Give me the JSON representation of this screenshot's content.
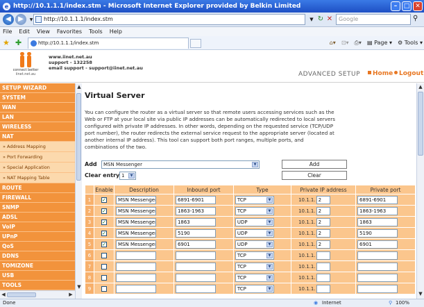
{
  "window": {
    "title": "http://10.1.1.1/index.stm - Microsoft Internet Explorer provided by Belkin Limited"
  },
  "address": {
    "url": "http://10.1.1.1/index.stm"
  },
  "search": {
    "placeholder": "Google"
  },
  "menu": [
    "File",
    "Edit",
    "View",
    "Favorites",
    "Tools",
    "Help"
  ],
  "tab": {
    "label": "http://10.1.1.1/index.stm"
  },
  "commands": {
    "page": "Page",
    "tools": "Tools"
  },
  "header": {
    "logo_tagline": "connect better",
    "logo_site": "iinet.net.au",
    "website": "www.iinet.net.au",
    "support_phone": "support - 132258",
    "support_email": "email support - support@iinet.net.au",
    "advanced_setup": "ADVANCED SETUP",
    "home_link": "Home",
    "logout_link": "Logout"
  },
  "sidebar": {
    "items": [
      {
        "label": "SETUP WIZARD",
        "sub": false
      },
      {
        "label": "SYSTEM",
        "sub": false
      },
      {
        "label": "WAN",
        "sub": false
      },
      {
        "label": "LAN",
        "sub": false
      },
      {
        "label": "WIRELESS",
        "sub": false
      },
      {
        "label": "NAT",
        "sub": false
      },
      {
        "label": "» Address Mapping",
        "sub": true
      },
      {
        "label": "» Port Forwarding",
        "sub": true
      },
      {
        "label": "» Special Application",
        "sub": true
      },
      {
        "label": "» NAT Mapping Table",
        "sub": true
      },
      {
        "label": "ROUTE",
        "sub": false
      },
      {
        "label": "FIREWALL",
        "sub": false
      },
      {
        "label": "SNMP",
        "sub": false
      },
      {
        "label": "ADSL",
        "sub": false
      },
      {
        "label": "VoIP",
        "sub": false
      },
      {
        "label": "UPnP",
        "sub": false
      },
      {
        "label": "QoS",
        "sub": false
      },
      {
        "label": "DDNS",
        "sub": false
      },
      {
        "label": "TOMIZONE",
        "sub": false
      },
      {
        "label": "USB",
        "sub": false
      },
      {
        "label": "TOOLS",
        "sub": false
      }
    ]
  },
  "main": {
    "title": "Virtual Server",
    "description": "You can configure the router as a virtual server so that remote users accessing services such as the Web or FTP at your local site via public IP addresses can be automatically redirected to local servers configured with private IP addresses. In other words, depending on the requested service (TCP/UDP port number), the router redirects the external service request to the appropriate server (located at another internal IP address). This tool can support both port ranges, multiple ports, and combinations of the two.",
    "add_label": "Add",
    "add_value": "MSN Messenger",
    "add_button": "Add",
    "clear_label": "Clear entry",
    "clear_value": "1",
    "clear_button": "Clear"
  },
  "table": {
    "headers": [
      "Enable",
      "Description",
      "Inbound port",
      "Type",
      "Private IP address",
      "Private port"
    ],
    "ip_prefix": "10.1.1.",
    "rows": [
      {
        "num": "1",
        "enabled": true,
        "desc": "MSN Messenger",
        "inbound": "6891-6901",
        "type": "TCP",
        "ip": "2",
        "private": "6891-6901"
      },
      {
        "num": "2",
        "enabled": true,
        "desc": "MSN Messenger",
        "inbound": "1863-1963",
        "type": "TCP",
        "ip": "2",
        "private": "1863-1963"
      },
      {
        "num": "3",
        "enabled": true,
        "desc": "MSN Messenger",
        "inbound": "1863",
        "type": "UDP",
        "ip": "2",
        "private": "1863"
      },
      {
        "num": "4",
        "enabled": true,
        "desc": "MSN Messenger",
        "inbound": "5190",
        "type": "UDP",
        "ip": "2",
        "private": "5190"
      },
      {
        "num": "5",
        "enabled": true,
        "desc": "MSN Messenger",
        "inbound": "6901",
        "type": "UDP",
        "ip": "2",
        "private": "6901"
      },
      {
        "num": "6",
        "enabled": false,
        "desc": "",
        "inbound": "",
        "type": "TCP",
        "ip": "",
        "private": ""
      },
      {
        "num": "7",
        "enabled": false,
        "desc": "",
        "inbound": "",
        "type": "TCP",
        "ip": "",
        "private": ""
      },
      {
        "num": "8",
        "enabled": false,
        "desc": "",
        "inbound": "",
        "type": "TCP",
        "ip": "",
        "private": ""
      },
      {
        "num": "9",
        "enabled": false,
        "desc": "",
        "inbound": "",
        "type": "TCP",
        "ip": "",
        "private": ""
      }
    ]
  },
  "status": {
    "left": "Done",
    "zone": "Internet",
    "zoom": "100%"
  }
}
